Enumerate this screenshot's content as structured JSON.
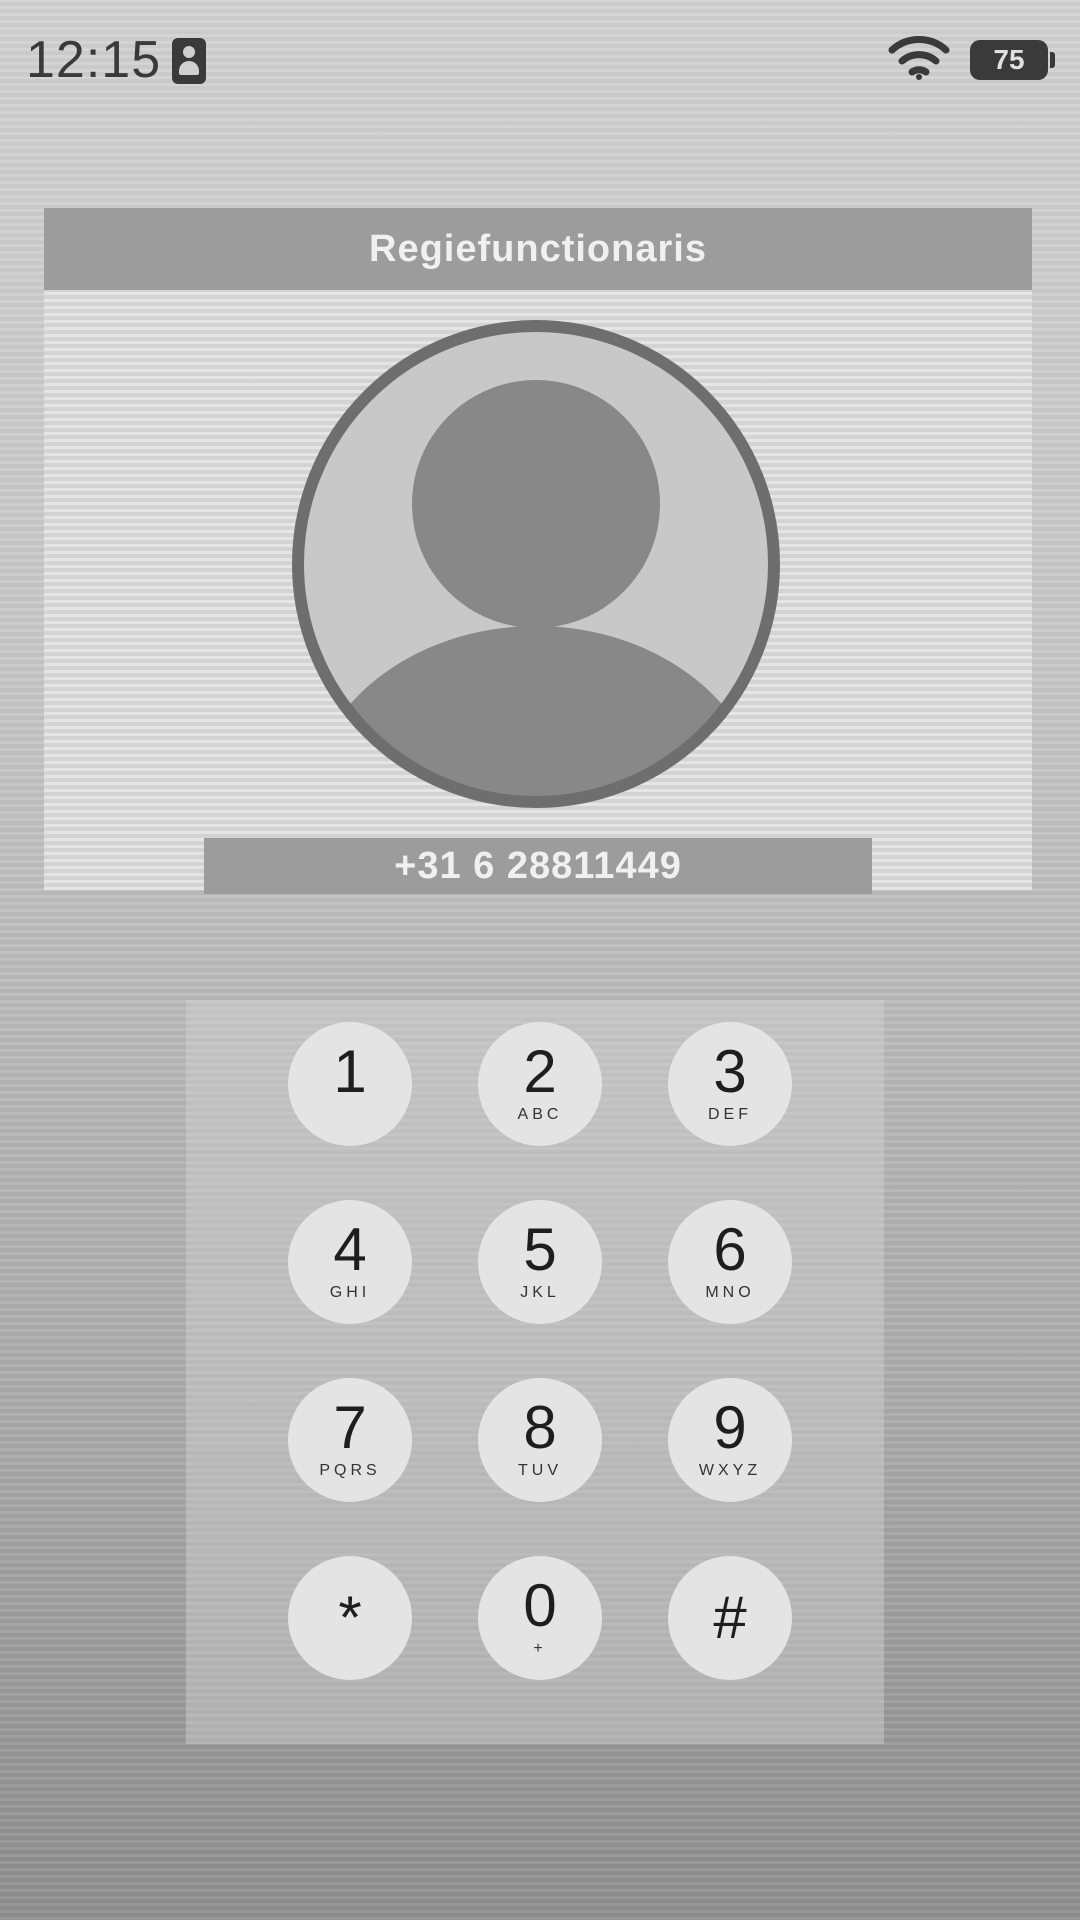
{
  "status_bar": {
    "time": "12:15",
    "battery": "75"
  },
  "contact": {
    "name": "Regiefunctionaris",
    "phone": "+31 6 28811449"
  },
  "keypad": {
    "keys": [
      {
        "digit": "1",
        "letters": ""
      },
      {
        "digit": "2",
        "letters": "ABC"
      },
      {
        "digit": "3",
        "letters": "DEF"
      },
      {
        "digit": "4",
        "letters": "GHI"
      },
      {
        "digit": "5",
        "letters": "JKL"
      },
      {
        "digit": "6",
        "letters": "MNO"
      },
      {
        "digit": "7",
        "letters": "PQRS"
      },
      {
        "digit": "8",
        "letters": "TUV"
      },
      {
        "digit": "9",
        "letters": "WXYZ"
      },
      {
        "digit": "*",
        "letters": ""
      },
      {
        "digit": "0",
        "letters": "+"
      },
      {
        "digit": "#",
        "letters": ""
      }
    ]
  }
}
